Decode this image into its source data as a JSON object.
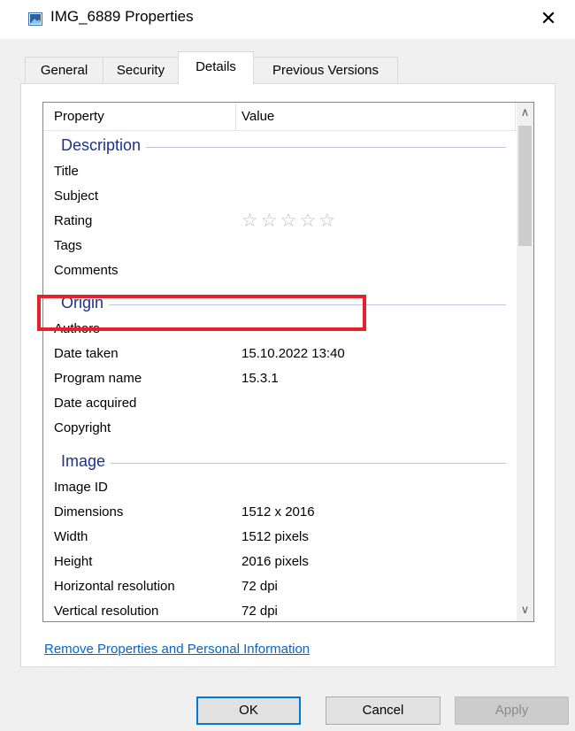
{
  "window": {
    "title": "IMG_6889 Properties",
    "close_glyph": "✕",
    "icon": "image-file-icon"
  },
  "tabs": [
    {
      "label": "General",
      "selected": false
    },
    {
      "label": "Security",
      "selected": false
    },
    {
      "label": "Details",
      "selected": true
    },
    {
      "label": "Previous Versions",
      "selected": false
    }
  ],
  "list": {
    "columns": {
      "property": "Property",
      "value": "Value"
    },
    "groups": {
      "description": "Description",
      "origin": "Origin",
      "image": "Image"
    },
    "rows": {
      "title": {
        "name": "Title",
        "value": ""
      },
      "subject": {
        "name": "Subject",
        "value": ""
      },
      "rating": {
        "name": "Rating",
        "stars": "☆☆☆☆☆",
        "rating": 0
      },
      "tags": {
        "name": "Tags",
        "value": ""
      },
      "comments": {
        "name": "Comments",
        "value": ""
      },
      "authors": {
        "name": "Authors",
        "value": ""
      },
      "date_taken": {
        "name": "Date taken",
        "value": "15.10.2022 13:40"
      },
      "program_name": {
        "name": "Program name",
        "value": "15.3.1"
      },
      "date_acquired": {
        "name": "Date acquired",
        "value": ""
      },
      "copyright": {
        "name": "Copyright",
        "value": ""
      },
      "image_id": {
        "name": "Image ID",
        "value": ""
      },
      "dimensions": {
        "name": "Dimensions",
        "value": "1512 x 2016"
      },
      "width": {
        "name": "Width",
        "value": "1512 pixels"
      },
      "height": {
        "name": "Height",
        "value": "2016 pixels"
      },
      "hres": {
        "name": "Horizontal resolution",
        "value": "72 dpi"
      },
      "vres": {
        "name": "Vertical resolution",
        "value": "72 dpi"
      }
    },
    "scroll_up_glyph": "∧",
    "scroll_down_glyph": "∨"
  },
  "annotation": {
    "color": "#e8202a",
    "target": "Date taken"
  },
  "link": {
    "label": "Remove Properties and Personal Information"
  },
  "buttons": {
    "ok": "OK",
    "cancel": "Cancel",
    "apply": "Apply",
    "apply_enabled": false
  },
  "colors": {
    "accent": "#0078d7",
    "link": "#0066cc",
    "group_header": "#1e3287"
  }
}
